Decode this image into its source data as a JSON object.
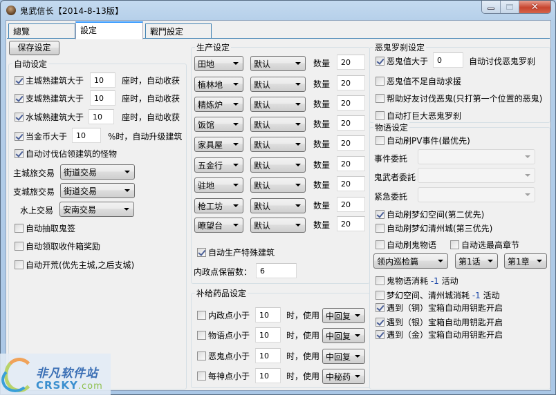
{
  "window": {
    "title": "鬼武信长【2014-8-13版】",
    "controls": {
      "minimize": "minimize-icon",
      "maximize": "maximize-icon",
      "close": "close-icon"
    }
  },
  "tabs": [
    {
      "label": "總覽",
      "active": false
    },
    {
      "label": "設定",
      "active": true
    },
    {
      "label": "戰鬥設定",
      "active": false
    }
  ],
  "toolbar": {
    "save_label": "保存设定"
  },
  "auto_settings": {
    "title": "自动设定",
    "rows": [
      {
        "label": "主城熟建筑大于",
        "checked": true,
        "value": "10",
        "suffix": "座时，自动收获"
      },
      {
        "label": "支城熟建筑大于",
        "checked": true,
        "value": "10",
        "suffix": "座时，自动收获"
      },
      {
        "label": "水城熟建筑大于",
        "checked": true,
        "value": "10",
        "suffix": "座时，自动收获"
      },
      {
        "label": "当金币大于",
        "checked": true,
        "value": "10",
        "suffix": "%时，自动升级建筑"
      }
    ],
    "attack_monsters": {
      "label": "自动讨伐佔领建筑的怪物",
      "checked": true
    },
    "trades": [
      {
        "label": "主城旅交易",
        "value": "街道交易"
      },
      {
        "label": "支城旅交易",
        "value": "街道交易"
      },
      {
        "label": "水上交易",
        "value": "安南交易"
      }
    ],
    "options": [
      {
        "label": "自动抽取鬼签",
        "checked": false
      },
      {
        "label": "自动领取收件箱奖励",
        "checked": false
      },
      {
        "label": "自动开荒(优先主城,之后支城)",
        "checked": false
      }
    ]
  },
  "production": {
    "title": "生产设定",
    "qty_label": "数量",
    "rows": [
      {
        "building": "田地",
        "mode": "默认",
        "qty": "20"
      },
      {
        "building": "植林地",
        "mode": "默认",
        "qty": "20"
      },
      {
        "building": "精炼炉",
        "mode": "默认",
        "qty": "20"
      },
      {
        "building": "饭馆",
        "mode": "默认",
        "qty": "20"
      },
      {
        "building": "家具屋",
        "mode": "默认",
        "qty": "20"
      },
      {
        "building": "五金行",
        "mode": "默认",
        "qty": "20"
      },
      {
        "building": "驻地",
        "mode": "默认",
        "qty": "20"
      },
      {
        "building": "枪工坊",
        "mode": "默认",
        "qty": "20"
      },
      {
        "building": "瞭望台",
        "mode": "默认",
        "qty": "20"
      }
    ],
    "special": {
      "label": "自动生产特殊建筑",
      "checked": true
    },
    "reserve": {
      "label": "内政点保留数：",
      "value": "6"
    }
  },
  "medicine": {
    "title": "补给药品设定",
    "use_label": "时，使用",
    "rows": [
      {
        "label": "内政点小于",
        "checked": false,
        "value": "10",
        "item": "中回复"
      },
      {
        "label": "物语点小于",
        "checked": false,
        "value": "10",
        "item": "中回复"
      },
      {
        "label": "恶鬼点小于",
        "checked": false,
        "value": "10",
        "item": "中回复"
      },
      {
        "label": "每神点小于",
        "checked": false,
        "value": "10",
        "item": "中秘药"
      }
    ]
  },
  "demon": {
    "title": "恶鬼罗刹设定",
    "threshold": {
      "label": "恶鬼值大于",
      "checked": true,
      "value": "0",
      "suffix": "自动讨伐恶鬼罗刹"
    },
    "options": [
      {
        "label": "恶鬼值不足自动求援",
        "checked": false
      },
      {
        "label": "帮助好友讨伐恶鬼(只打第一个位置的恶鬼)",
        "checked": false
      },
      {
        "label": "自动打巨大恶鬼罗刹",
        "checked": false
      }
    ]
  },
  "story": {
    "title": "物语设定",
    "pv": {
      "label": "自动刷PV事件(最优先)",
      "checked": false
    },
    "commissions": [
      {
        "label": "事件委託",
        "value": ""
      },
      {
        "label": "鬼武者委託",
        "value": ""
      },
      {
        "label": "紧急委託",
        "value": ""
      }
    ],
    "dream_space": {
      "label": "自动刷梦幻空间(第二优先)",
      "checked": true
    },
    "dream_city": {
      "label": "自动刷梦幻清州城(第三优先)",
      "checked": false
    },
    "ghost_story": {
      "label": "自动刷鬼物语",
      "checked": false
    },
    "highest_chapter": {
      "label": "自动选最高章节",
      "checked": false
    },
    "chapter_select": {
      "arc": "领内巡检篇",
      "episode": "第1话",
      "chapter": "第1章"
    },
    "consume": [
      {
        "label_pre": "鬼物语消耗",
        "label_num": "-1",
        "label_post": "活动",
        "checked": false
      },
      {
        "label_pre": "梦幻空间、清州城消耗",
        "label_num": "-1",
        "label_post": "活动",
        "checked": false
      }
    ],
    "chests": [
      {
        "label": "遇到（铜）宝箱自动用钥匙开启",
        "checked": true
      },
      {
        "label": "遇到（银）宝箱自动用钥匙开启",
        "checked": true
      },
      {
        "label": "遇到（金）宝箱自动用钥匙开启",
        "checked": true
      }
    ]
  },
  "watermark": {
    "cn": "非凡软件站",
    "en": "CRSKY",
    "domain": ".com"
  }
}
